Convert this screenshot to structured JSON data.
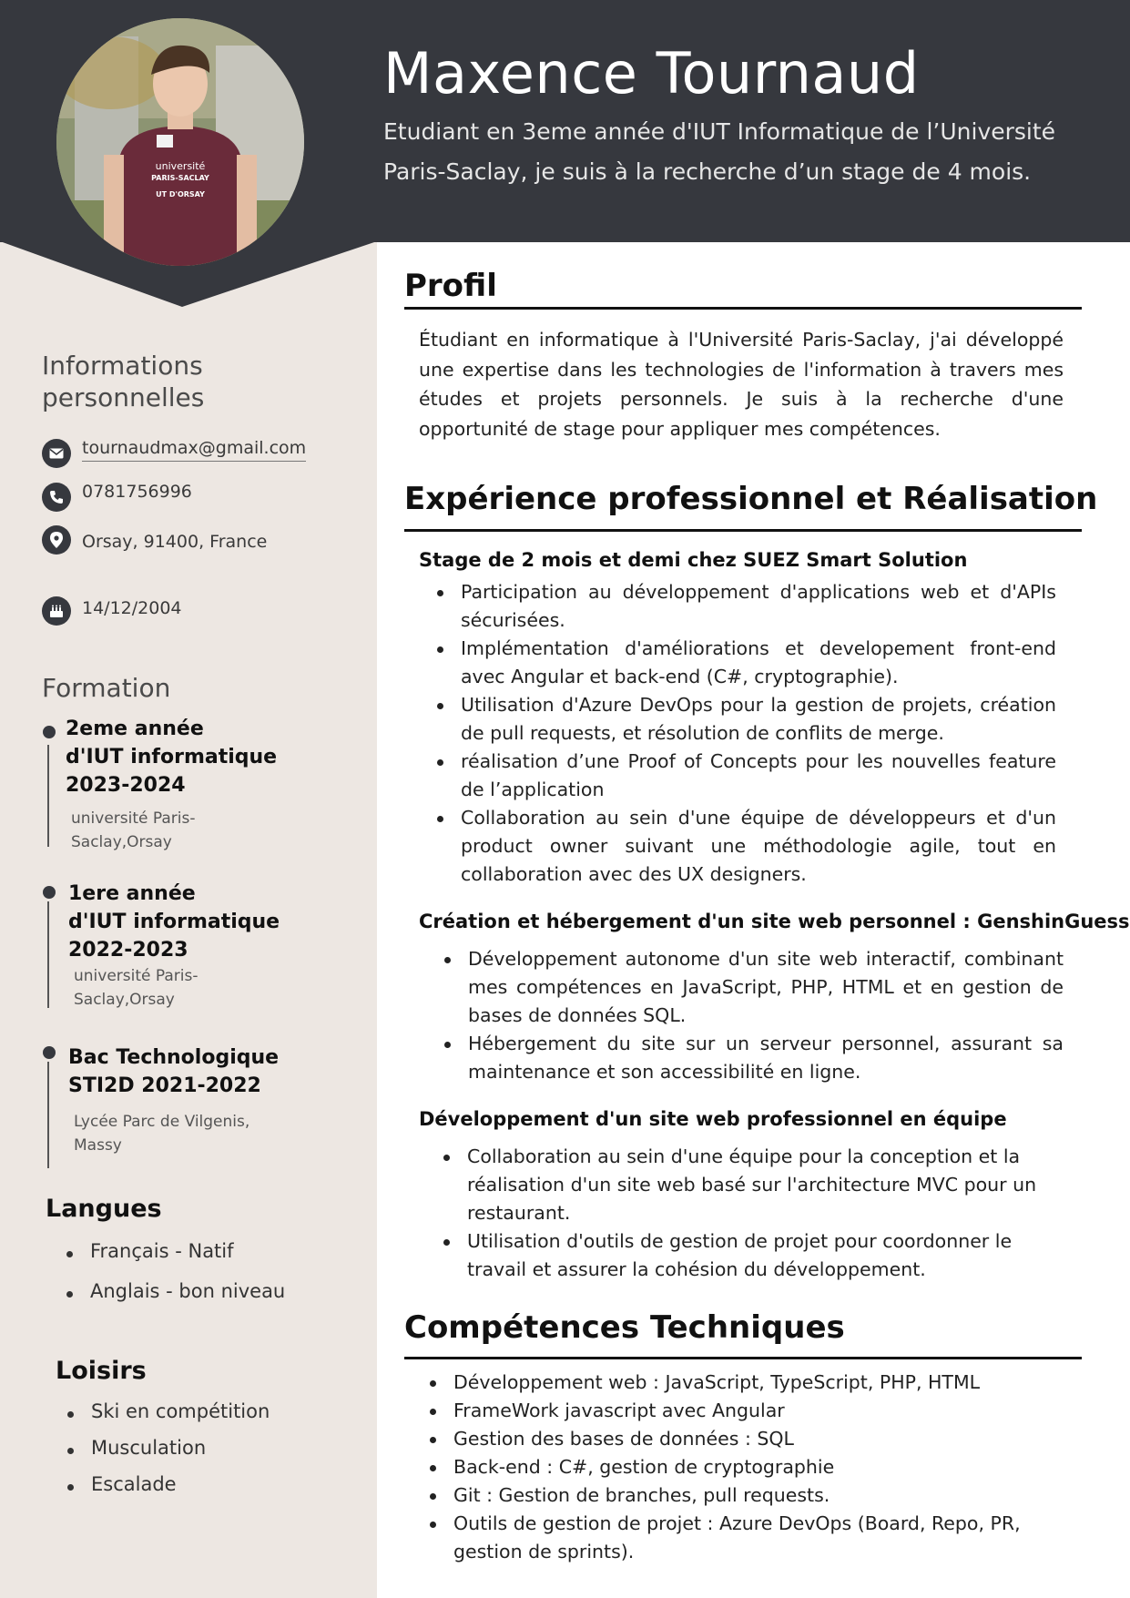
{
  "header": {
    "name": "Maxence Tournaud",
    "tagline": "Etudiant en 3eme année d'IUT Informatique de l’Université Paris-Saclay, je suis à la recherche d’un stage de 4 mois.",
    "shirt_text": [
      "université",
      "PARIS-SACLAY",
      "UT D'ORSAY"
    ]
  },
  "sidebar": {
    "info_title": [
      "Informations",
      "personnelles"
    ],
    "email": "tournaudmax@gmail.com",
    "phone": "0781756996",
    "location": "Orsay, 91400, France",
    "birthdate": "14/12/2004",
    "formation_title": "Formation",
    "education": [
      {
        "title": [
          "2eme année",
          "d'IUT informatique",
          "2023-2024"
        ],
        "school": [
          "université Paris-",
          "Saclay,Orsay"
        ]
      },
      {
        "title": [
          "1ere année",
          "d'IUT informatique",
          "2022-2023"
        ],
        "school": [
          "université Paris-",
          "Saclay,Orsay"
        ]
      },
      {
        "title": [
          "Bac Technologique",
          "STI2D 2021-2022"
        ],
        "school": [
          "Lycée Parc de Vilgenis,",
          "Massy"
        ]
      }
    ],
    "languages_title": "Langues",
    "languages": [
      "Français - Natif",
      "Anglais - bon niveau"
    ],
    "hobbies_title": "Loisirs",
    "hobbies": [
      "Ski en compétition",
      "Musculation",
      "Escalade"
    ]
  },
  "main": {
    "profil_title": "Profil",
    "profil_text": "Étudiant en informatique à l'Université Paris-Saclay, j'ai développé une expertise dans les technologies de l'information à travers mes études et projets personnels. Je suis à la recherche d'une opportunité de stage pour appliquer mes compétences.",
    "experience_title": "Expérience professionnel et Réalisation",
    "jobs": [
      {
        "title": "Stage de 2 mois et demi chez SUEZ Smart Solution",
        "bullets": [
          "Participation au développement d'applications web et d'APIs sécurisées.",
          "Implémentation d'améliorations et developement front-end avec Angular et back-end (C#, cryptographie).",
          "Utilisation d'Azure DevOps pour la gestion de projets, création de pull requests, et résolution de conflits de merge.",
          "réalisation d’une Proof of Concepts pour les nouvelles feature de l’application",
          "Collaboration au sein d'une équipe de développeurs et d'un product owner suivant une méthodologie agile, tout en collaboration avec des UX designers."
        ]
      },
      {
        "title": "Création et hébergement d'un site web personnel : GenshinGuess",
        "bullets": [
          "Développement autonome d'un site web interactif, combinant mes compétences en JavaScript, PHP, HTML et en gestion de bases de données SQL.",
          "Hébergement du site sur un serveur personnel, assurant sa maintenance et son accessibilité en ligne."
        ]
      },
      {
        "title": "Développement d'un site web professionnel en équipe",
        "bullets": [
          "Collaboration au sein d'une équipe pour la conception et la réalisation d'un site web basé sur l'architecture MVC pour un restaurant.",
          "Utilisation d'outils de gestion de projet pour coordonner le travail et assurer la cohésion du développement."
        ]
      }
    ],
    "skills_title": "Compétences Techniques",
    "skills": [
      "Développement web : JavaScript, TypeScript, PHP, HTML",
      "FrameWork javascript avec Angular",
      "Gestion des bases de données : SQL",
      "Back-end : C#, gestion de cryptographie",
      "Git : Gestion de branches, pull requests.",
      "Outils de gestion de projet : Azure DevOps (Board, Repo, PR, gestion de sprints)."
    ]
  }
}
